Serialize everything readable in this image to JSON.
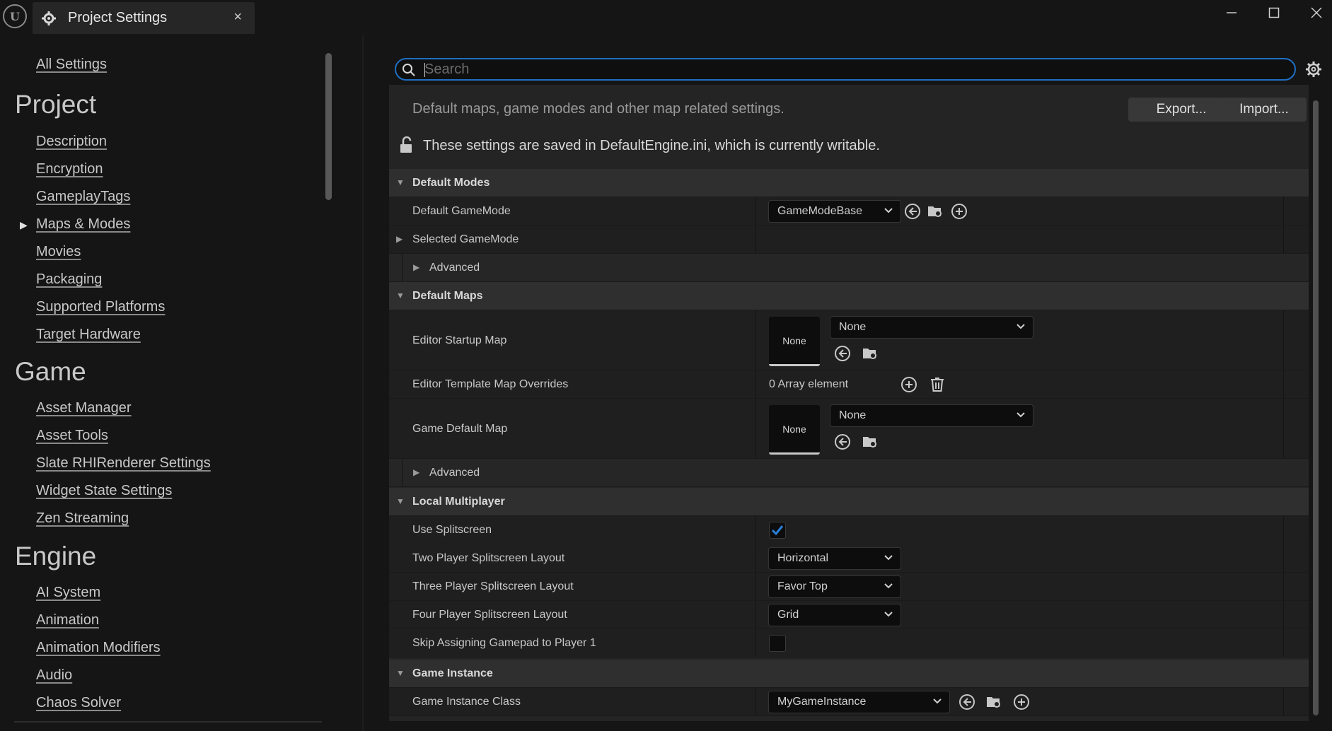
{
  "window": {
    "tab_title": "Project Settings",
    "close_glyph": "×",
    "minimize_glyph": "—",
    "maximize_glyph": "☐",
    "close_window_glyph": "✕"
  },
  "sidebar": {
    "all_settings": "All Settings",
    "categories": [
      {
        "title": "Project",
        "items": [
          "Description",
          "Encryption",
          "GameplayTags",
          "Maps & Modes",
          "Movies",
          "Packaging",
          "Supported Platforms",
          "Target Hardware"
        ]
      },
      {
        "title": "Game",
        "items": [
          "Asset Manager",
          "Asset Tools",
          "Slate RHIRenderer Settings",
          "Widget State Settings",
          "Zen Streaming"
        ]
      },
      {
        "title": "Engine",
        "items": [
          "AI System",
          "Animation",
          "Animation Modifiers",
          "Audio",
          "Chaos Solver"
        ]
      }
    ],
    "selected_item": "Maps & Modes"
  },
  "search": {
    "placeholder": "Search",
    "value": ""
  },
  "header": {
    "description": "Default maps, game modes and other map related settings.",
    "export_label": "Export...",
    "import_label": "Import...",
    "writable_text": "These settings are saved in DefaultEngine.ini, which is currently writable."
  },
  "sections": {
    "default_modes": {
      "title": "Default Modes",
      "default_gamemode_label": "Default GameMode",
      "default_gamemode_value": "GameModeBase",
      "selected_gamemode_label": "Selected GameMode",
      "advanced_label": "Advanced"
    },
    "default_maps": {
      "title": "Default Maps",
      "editor_startup_map_label": "Editor Startup Map",
      "editor_startup_map_thumb": "None",
      "editor_startup_map_value": "None",
      "template_overrides_label": "Editor Template Map Overrides",
      "template_overrides_value": "0 Array element",
      "game_default_map_label": "Game Default Map",
      "game_default_map_thumb": "None",
      "game_default_map_value": "None",
      "advanced_label": "Advanced"
    },
    "local_multiplayer": {
      "title": "Local Multiplayer",
      "use_splitscreen_label": "Use Splitscreen",
      "use_splitscreen_checked": true,
      "two_player_label": "Two Player Splitscreen Layout",
      "two_player_value": "Horizontal",
      "three_player_label": "Three Player Splitscreen Layout",
      "three_player_value": "Favor Top",
      "four_player_label": "Four Player Splitscreen Layout",
      "four_player_value": "Grid",
      "skip_gamepad_label": "Skip Assigning Gamepad to Player 1",
      "skip_gamepad_checked": false
    },
    "game_instance": {
      "title": "Game Instance",
      "class_label": "Game Instance Class",
      "class_value": "MyGameInstance"
    }
  },
  "colors": {
    "accent": "#1f6fc4",
    "checkbox_check": "#2a7fd9"
  }
}
